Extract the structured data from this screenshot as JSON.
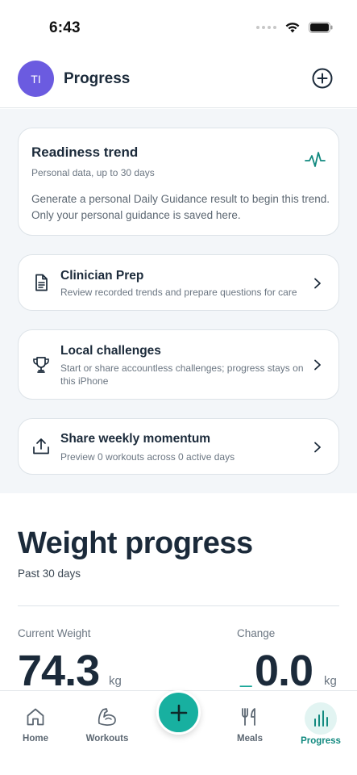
{
  "status_bar": {
    "time": "6:43"
  },
  "header": {
    "avatar_initials": "TI",
    "title": "Progress"
  },
  "readiness_card": {
    "title": "Readiness trend",
    "subtitle": "Personal data, up to 30 days",
    "body": "Generate a personal Daily Guidance result to begin this trend. Only your personal guidance is saved here.",
    "icon": "pulse-icon"
  },
  "nav_cards": [
    {
      "title": "Clinician Prep",
      "subtitle": "Review recorded trends and prepare questions for care",
      "icon": "document-icon"
    },
    {
      "title": "Local challenges",
      "subtitle": "Start or share accountless challenges; progress stays on this iPhone",
      "icon": "trophy-icon"
    },
    {
      "title": "Share weekly momentum",
      "subtitle": "Preview 0 workouts across 0 active days",
      "icon": "share-icon"
    }
  ],
  "weight": {
    "title": "Weight progress",
    "period": "Past 30 days",
    "current_label": "Current Weight",
    "current_value": "74.3",
    "current_unit": "kg",
    "change_label": "Change",
    "change_sign": "_",
    "change_value": "0.0",
    "change_unit": "kg"
  },
  "tabbar": {
    "tabs": [
      {
        "label": "Home",
        "icon": "home-icon"
      },
      {
        "label": "Workouts",
        "icon": "bicep-icon"
      },
      {
        "label": "Meals",
        "icon": "fork-knife-icon"
      },
      {
        "label": "Progress",
        "icon": "bar-chart-icon",
        "active": true
      }
    ],
    "fab_icon": "plus-icon"
  },
  "colors": {
    "accent": "#18b0a0",
    "avatar": "#6b5be0",
    "text": "#1b2a3a",
    "section_bg": "#f3f6f9"
  }
}
